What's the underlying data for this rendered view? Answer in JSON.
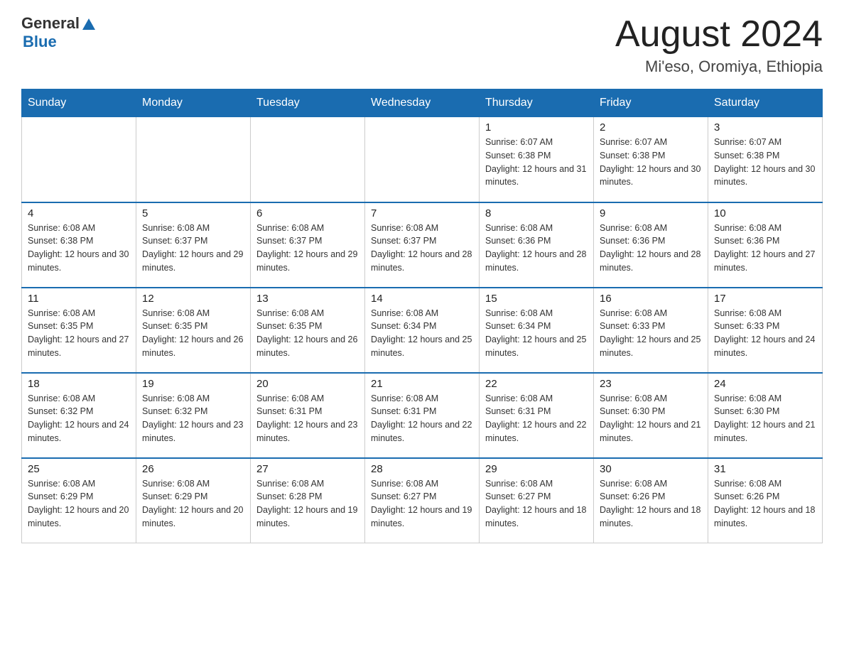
{
  "header": {
    "logo_general": "General",
    "logo_blue": "Blue",
    "title": "August 2024",
    "subtitle": "Mi'eso, Oromiya, Ethiopia"
  },
  "days_of_week": [
    "Sunday",
    "Monday",
    "Tuesday",
    "Wednesday",
    "Thursday",
    "Friday",
    "Saturday"
  ],
  "weeks": [
    [
      {
        "day": "",
        "info": ""
      },
      {
        "day": "",
        "info": ""
      },
      {
        "day": "",
        "info": ""
      },
      {
        "day": "",
        "info": ""
      },
      {
        "day": "1",
        "info": "Sunrise: 6:07 AM\nSunset: 6:38 PM\nDaylight: 12 hours and 31 minutes."
      },
      {
        "day": "2",
        "info": "Sunrise: 6:07 AM\nSunset: 6:38 PM\nDaylight: 12 hours and 30 minutes."
      },
      {
        "day": "3",
        "info": "Sunrise: 6:07 AM\nSunset: 6:38 PM\nDaylight: 12 hours and 30 minutes."
      }
    ],
    [
      {
        "day": "4",
        "info": "Sunrise: 6:08 AM\nSunset: 6:38 PM\nDaylight: 12 hours and 30 minutes."
      },
      {
        "day": "5",
        "info": "Sunrise: 6:08 AM\nSunset: 6:37 PM\nDaylight: 12 hours and 29 minutes."
      },
      {
        "day": "6",
        "info": "Sunrise: 6:08 AM\nSunset: 6:37 PM\nDaylight: 12 hours and 29 minutes."
      },
      {
        "day": "7",
        "info": "Sunrise: 6:08 AM\nSunset: 6:37 PM\nDaylight: 12 hours and 28 minutes."
      },
      {
        "day": "8",
        "info": "Sunrise: 6:08 AM\nSunset: 6:36 PM\nDaylight: 12 hours and 28 minutes."
      },
      {
        "day": "9",
        "info": "Sunrise: 6:08 AM\nSunset: 6:36 PM\nDaylight: 12 hours and 28 minutes."
      },
      {
        "day": "10",
        "info": "Sunrise: 6:08 AM\nSunset: 6:36 PM\nDaylight: 12 hours and 27 minutes."
      }
    ],
    [
      {
        "day": "11",
        "info": "Sunrise: 6:08 AM\nSunset: 6:35 PM\nDaylight: 12 hours and 27 minutes."
      },
      {
        "day": "12",
        "info": "Sunrise: 6:08 AM\nSunset: 6:35 PM\nDaylight: 12 hours and 26 minutes."
      },
      {
        "day": "13",
        "info": "Sunrise: 6:08 AM\nSunset: 6:35 PM\nDaylight: 12 hours and 26 minutes."
      },
      {
        "day": "14",
        "info": "Sunrise: 6:08 AM\nSunset: 6:34 PM\nDaylight: 12 hours and 25 minutes."
      },
      {
        "day": "15",
        "info": "Sunrise: 6:08 AM\nSunset: 6:34 PM\nDaylight: 12 hours and 25 minutes."
      },
      {
        "day": "16",
        "info": "Sunrise: 6:08 AM\nSunset: 6:33 PM\nDaylight: 12 hours and 25 minutes."
      },
      {
        "day": "17",
        "info": "Sunrise: 6:08 AM\nSunset: 6:33 PM\nDaylight: 12 hours and 24 minutes."
      }
    ],
    [
      {
        "day": "18",
        "info": "Sunrise: 6:08 AM\nSunset: 6:32 PM\nDaylight: 12 hours and 24 minutes."
      },
      {
        "day": "19",
        "info": "Sunrise: 6:08 AM\nSunset: 6:32 PM\nDaylight: 12 hours and 23 minutes."
      },
      {
        "day": "20",
        "info": "Sunrise: 6:08 AM\nSunset: 6:31 PM\nDaylight: 12 hours and 23 minutes."
      },
      {
        "day": "21",
        "info": "Sunrise: 6:08 AM\nSunset: 6:31 PM\nDaylight: 12 hours and 22 minutes."
      },
      {
        "day": "22",
        "info": "Sunrise: 6:08 AM\nSunset: 6:31 PM\nDaylight: 12 hours and 22 minutes."
      },
      {
        "day": "23",
        "info": "Sunrise: 6:08 AM\nSunset: 6:30 PM\nDaylight: 12 hours and 21 minutes."
      },
      {
        "day": "24",
        "info": "Sunrise: 6:08 AM\nSunset: 6:30 PM\nDaylight: 12 hours and 21 minutes."
      }
    ],
    [
      {
        "day": "25",
        "info": "Sunrise: 6:08 AM\nSunset: 6:29 PM\nDaylight: 12 hours and 20 minutes."
      },
      {
        "day": "26",
        "info": "Sunrise: 6:08 AM\nSunset: 6:29 PM\nDaylight: 12 hours and 20 minutes."
      },
      {
        "day": "27",
        "info": "Sunrise: 6:08 AM\nSunset: 6:28 PM\nDaylight: 12 hours and 19 minutes."
      },
      {
        "day": "28",
        "info": "Sunrise: 6:08 AM\nSunset: 6:27 PM\nDaylight: 12 hours and 19 minutes."
      },
      {
        "day": "29",
        "info": "Sunrise: 6:08 AM\nSunset: 6:27 PM\nDaylight: 12 hours and 18 minutes."
      },
      {
        "day": "30",
        "info": "Sunrise: 6:08 AM\nSunset: 6:26 PM\nDaylight: 12 hours and 18 minutes."
      },
      {
        "day": "31",
        "info": "Sunrise: 6:08 AM\nSunset: 6:26 PM\nDaylight: 12 hours and 18 minutes."
      }
    ]
  ]
}
